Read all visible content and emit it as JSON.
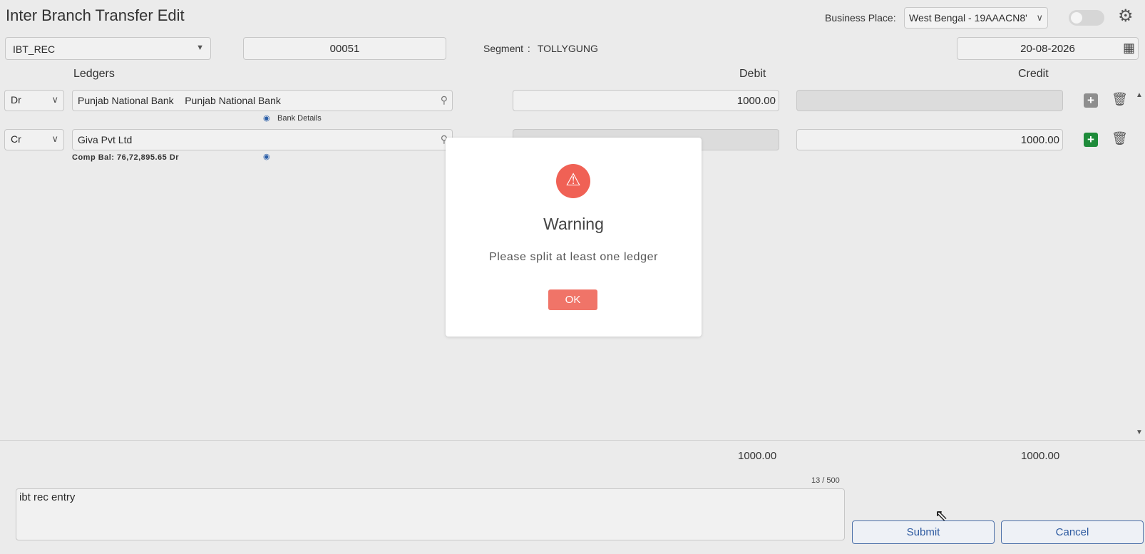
{
  "header": {
    "title": "Inter Branch Transfer Edit",
    "business_place_label": "Business Place:",
    "business_place_value": "West Bengal - 19AAACN8'"
  },
  "form": {
    "voucher_type": "IBT_REC",
    "voucher_no": "00051",
    "segment_label": "Segment :",
    "segment_value": "TOLLYGUNG",
    "date": "20-08-2026"
  },
  "table": {
    "headers": {
      "ledgers": "Ledgers",
      "debit": "Debit",
      "credit": "Credit"
    },
    "rows": [
      {
        "type": "Dr",
        "ledger": "Punjab National Bank    Punjab National Bank",
        "debit": "1000.00",
        "credit": "",
        "sub": "Bank Details"
      },
      {
        "type": "Cr",
        "ledger": "Giva Pvt Ltd",
        "debit": "",
        "credit": "1000.00",
        "sub": "Comp Bal: 76,72,895.65 Dr"
      }
    ]
  },
  "totals": {
    "debit": "1000.00",
    "credit": "1000.00"
  },
  "narration": {
    "value": "ibt rec entry",
    "counter": "13 / 500"
  },
  "buttons": {
    "submit": "Submit",
    "cancel": "Cancel"
  },
  "modal": {
    "icon": "warning-icon",
    "title": "Warning",
    "message": "Please split at least one ledger",
    "ok_label": "OK"
  },
  "colors": {
    "warning": "#f06155",
    "ok_button": "#f07468",
    "add_active": "#1e8b3a",
    "button_border": "#4b6fa8"
  }
}
